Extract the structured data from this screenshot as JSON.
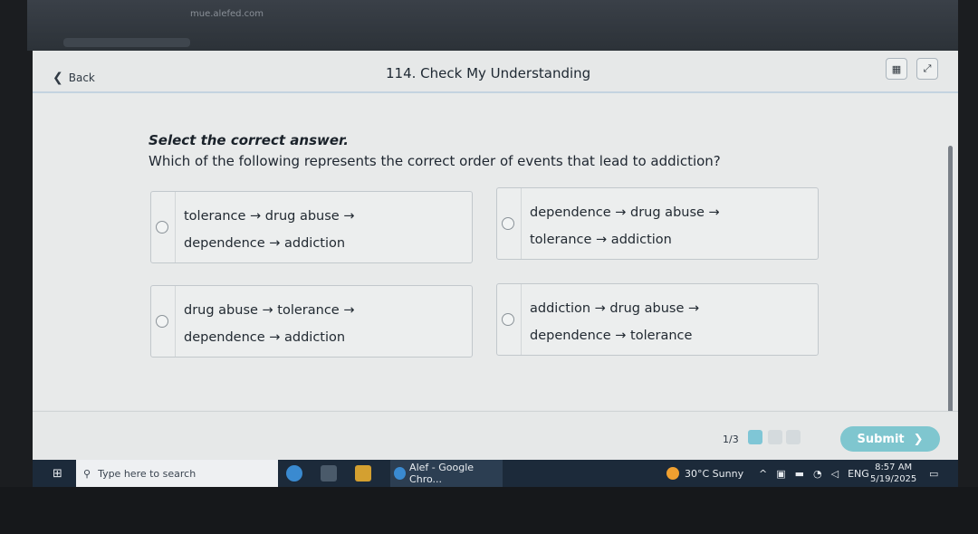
{
  "browser": {
    "url": "mue.alefed.com"
  },
  "header": {
    "back_label": "Back",
    "back_icon": "chevron-left-icon",
    "title": "114. Check My Understanding",
    "icons": [
      "calculator-icon",
      "expand-icon"
    ]
  },
  "main": {
    "instruction": "Select the correct answer.",
    "question": "Which of the following represents the correct order of events that lead to addiction?",
    "options": [
      {
        "line1": "tolerance → drug abuse →",
        "line2": "dependence → addiction"
      },
      {
        "line1": "dependence → drug abuse →",
        "line2": "tolerance → addiction"
      },
      {
        "line1": "drug abuse → tolerance →",
        "line2": "dependence → addiction"
      },
      {
        "line1": "addiction → drug abuse →",
        "line2": "dependence → tolerance"
      }
    ]
  },
  "footer": {
    "page_count": "1/3",
    "submit_label": "Submit",
    "submit_icon": "chevron-right-icon",
    "colors": {
      "active_dot": "#7fc6d6",
      "inactive_dot": "#d4dadd",
      "submit_bg": "#7fc6cf"
    }
  },
  "taskbar": {
    "search_placeholder": "Type here to search",
    "chrome_label": "Alef - Google Chro...",
    "weather": "30°C  Sunny",
    "language": "ENG",
    "time": "8:57 AM",
    "date": "5/19/2025"
  }
}
